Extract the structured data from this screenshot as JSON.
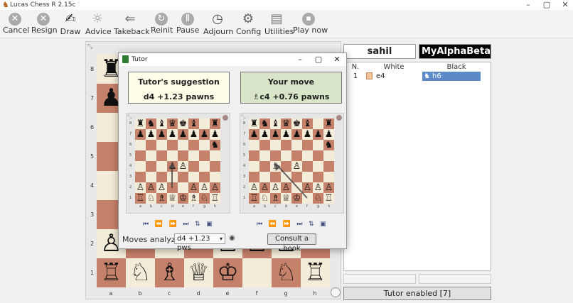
{
  "window": {
    "title": "Lucas Chess R 2.15c"
  },
  "toolbar": [
    {
      "label": "Cancel",
      "icon": "cancel-icon",
      "glyph": "✕"
    },
    {
      "label": "Resign",
      "icon": "resign-icon",
      "glyph": "✕"
    },
    {
      "label": "Draw",
      "icon": "draw-icon",
      "glyph": "✍"
    },
    {
      "label": "Advice",
      "icon": "advice-icon",
      "glyph": "☼"
    },
    {
      "label": "Takeback",
      "icon": "takeback-icon",
      "glyph": "⇐"
    },
    {
      "label": "Reinit",
      "icon": "reinit-icon",
      "glyph": "↻"
    },
    {
      "label": "Pause",
      "icon": "pause-icon",
      "glyph": "Ⅱ"
    },
    {
      "label": "Adjourn",
      "icon": "adjourn-icon",
      "glyph": "◷"
    },
    {
      "label": "Config",
      "icon": "config-icon",
      "glyph": "⚙"
    },
    {
      "label": "Utilities",
      "icon": "utilities-icon",
      "glyph": "▤"
    },
    {
      "label": "Play now",
      "icon": "play-now-icon",
      "glyph": "⏹"
    }
  ],
  "board": {
    "ranks": [
      "8",
      "7",
      "6",
      "5",
      "4",
      "3",
      "2",
      "1"
    ],
    "files": [
      "a",
      "b",
      "c",
      "d",
      "e",
      "f",
      "g",
      "h"
    ]
  },
  "players": {
    "white": "sahil",
    "black": "MyAlphaBetaCh"
  },
  "movelist": {
    "headers": [
      "N.",
      "White",
      "Black"
    ],
    "rows": [
      {
        "n": "1",
        "white": "e4",
        "black": "h6"
      }
    ]
  },
  "tutor": {
    "title": "Tutor",
    "suggestion_title": "Tutor's suggestion",
    "suggestion_eval": "d4 +1.23 pawns",
    "yourmove_title": "Your move",
    "yourmove_eval": "♗c4 +0.76 pawns",
    "moves_analyzed_label": "Moves analyzed:",
    "moves_analyzed_value": "d4 +1.23 pws",
    "consult_label": "Consult a book",
    "mini_ranks": [
      "8",
      "7",
      "6",
      "5",
      "4",
      "3",
      "2",
      "1"
    ],
    "mini_files": [
      "a",
      "b",
      "c",
      "d",
      "e",
      "f",
      "g",
      "h"
    ]
  },
  "status": {
    "tutor": "Tutor enabled [7]"
  },
  "colors": {
    "light": "#f3ecd8",
    "dark": "#c6816a",
    "suggestion_bg": "#fffde8",
    "yourmove_bg": "#d9e5c9",
    "selected": "#5b8ac7"
  }
}
